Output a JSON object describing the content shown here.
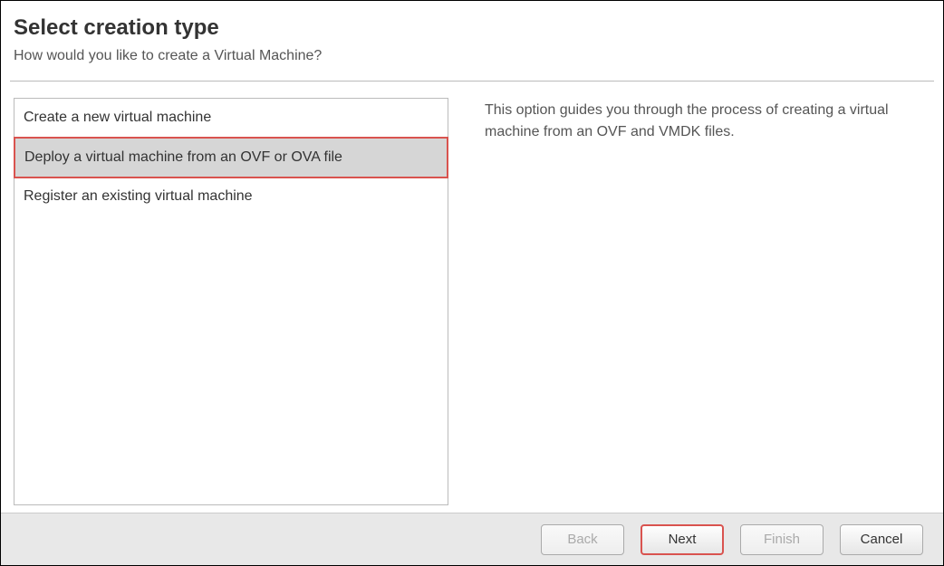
{
  "header": {
    "title": "Select creation type",
    "subtitle": "How would you like to create a Virtual Machine?"
  },
  "options": {
    "items": [
      {
        "label": "Create a new virtual machine"
      },
      {
        "label": "Deploy a virtual machine from an OVF or OVA file"
      },
      {
        "label": "Register an existing virtual machine"
      }
    ],
    "selected_index": 1
  },
  "description": "This option guides you through the process of creating a virtual machine from an OVF and VMDK files.",
  "footer": {
    "back": "Back",
    "next": "Next",
    "finish": "Finish",
    "cancel": "Cancel"
  }
}
